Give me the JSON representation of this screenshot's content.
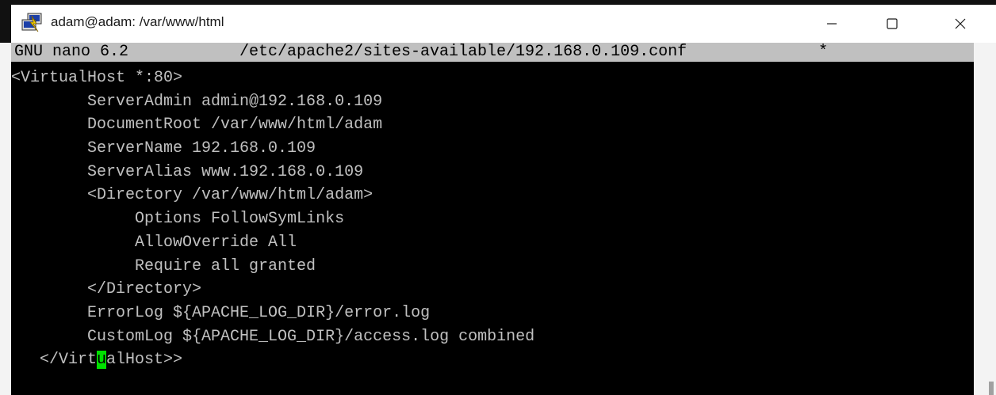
{
  "window": {
    "title": "adam@adam: /var/www/html",
    "icon": "putty-icon",
    "controls": {
      "minimize": "minimize-icon",
      "maximize": "maximize-icon",
      "close": "close-icon"
    }
  },
  "nano": {
    "version": "GNU nano 6.2",
    "filename": "/etc/apache2/sites-available/192.168.0.109.conf",
    "modified_marker": "*"
  },
  "file_lines": [
    "<VirtualHost *:80>",
    "        ServerAdmin admin@192.168.0.109",
    "        DocumentRoot /var/www/html/adam",
    "        ServerName 192.168.0.109",
    "        ServerAlias www.192.168.0.109",
    "        <Directory /var/www/html/adam>",
    "             Options FollowSymLinks",
    "             AllowOverride All",
    "             Require all granted",
    "        </Directory>",
    "        ErrorLog ${APACHE_LOG_DIR}/error.log",
    "        CustomLog ${APACHE_LOG_DIR}/access.log combined"
  ],
  "cursor_line": {
    "before": "   </Virt",
    "cursor_char": "u",
    "after": "alHost>>"
  },
  "colors": {
    "terminal_bg": "#000000",
    "terminal_fg": "#c0c0c0",
    "header_bg": "#c0c0c0",
    "cursor": "#00e000"
  }
}
